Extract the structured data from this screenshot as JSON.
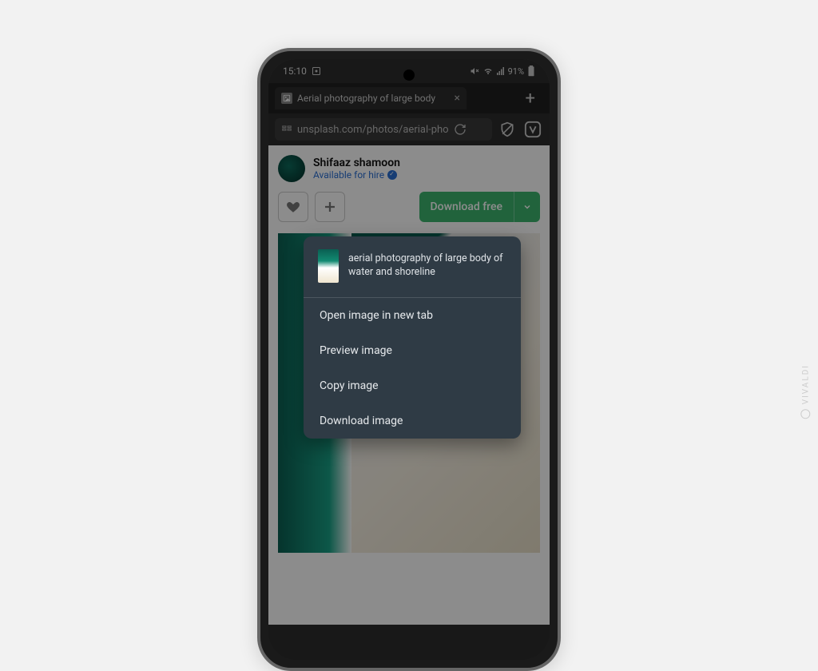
{
  "status": {
    "time": "15:10",
    "battery": "91%"
  },
  "tab": {
    "title": "Aerial photography of large body"
  },
  "url": {
    "text": "unsplash.com/photos/aerial-pho"
  },
  "author": {
    "name": "Shifaaz shamoon",
    "hire": "Available for hire"
  },
  "actions": {
    "download": "Download free"
  },
  "context_menu": {
    "header": "aerial photography of large body of water and shoreline",
    "items": [
      "Open image in new tab",
      "Preview image",
      "Copy image",
      "Download image"
    ]
  },
  "watermark": "VIVALDI"
}
